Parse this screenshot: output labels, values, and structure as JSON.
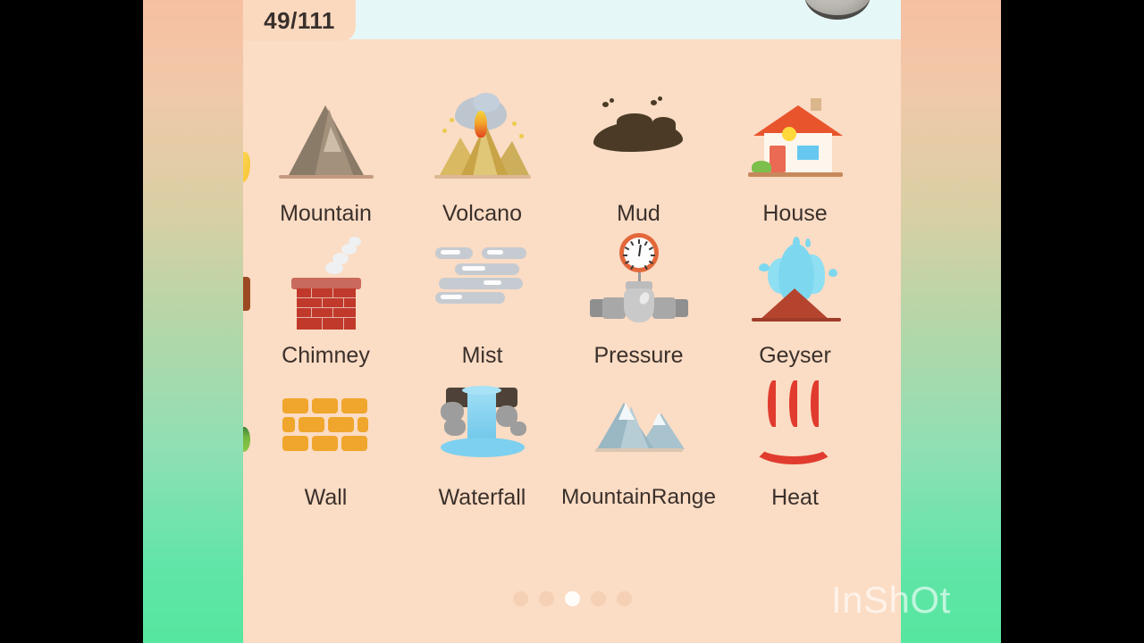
{
  "app": {
    "counter": "49/111",
    "panel_bg": "#fbdcc4",
    "header_bg": "#e6f7f8",
    "label_color": "#3a302b"
  },
  "header": {
    "coin_icon": "stone-coin-icon"
  },
  "grid": {
    "columns": 4,
    "items": [
      {
        "label": "Mountain",
        "icon": "mountain-icon"
      },
      {
        "label": "Volcano",
        "icon": "volcano-icon"
      },
      {
        "label": "Mud",
        "icon": "mud-icon"
      },
      {
        "label": "House",
        "icon": "house-icon"
      },
      {
        "label": "Chimney",
        "icon": "chimney-icon"
      },
      {
        "label": "Mist",
        "icon": "mist-icon"
      },
      {
        "label": "Pressure",
        "icon": "pressure-gauge-icon"
      },
      {
        "label": "Geyser",
        "icon": "geyser-icon"
      },
      {
        "label": "Wall",
        "icon": "brick-wall-icon"
      },
      {
        "label": "Waterfall",
        "icon": "waterfall-icon"
      },
      {
        "label": "MountainRange",
        "icon": "mountain-range-icon"
      },
      {
        "label": "Heat",
        "icon": "hot-springs-icon"
      }
    ]
  },
  "pagination": {
    "total_pages": 5,
    "active_page": 3,
    "active_color": "#fffdf9",
    "inactive_color": "#f5d0b4"
  },
  "watermark": {
    "text": "InShOt"
  },
  "background": {
    "top_color": "#f7bfa2",
    "bottom_color": "#55e69f"
  }
}
